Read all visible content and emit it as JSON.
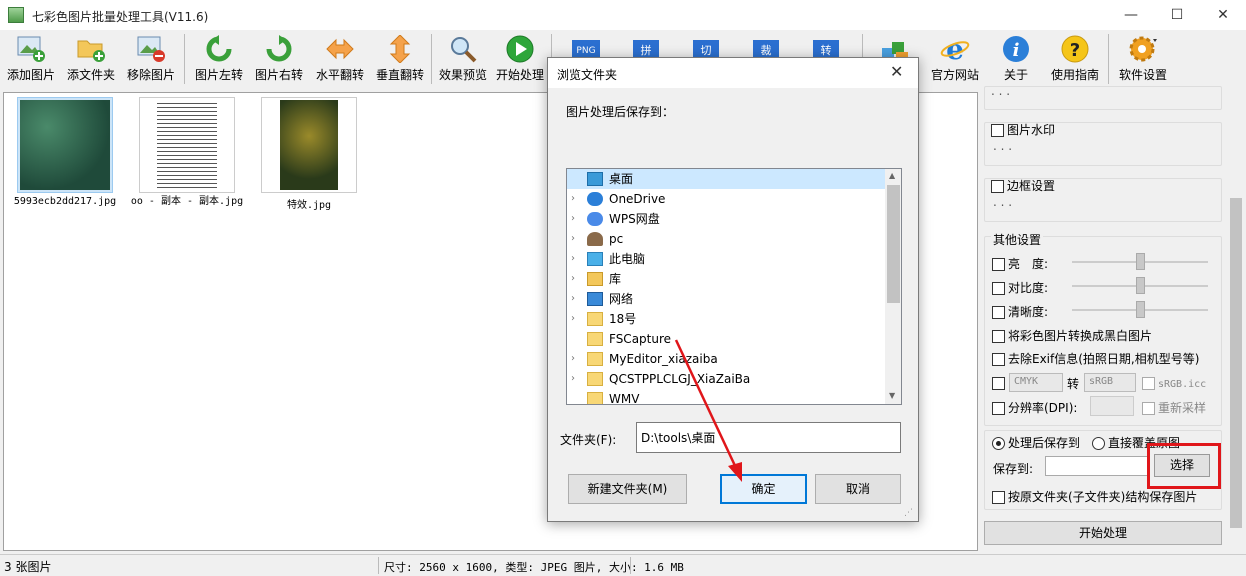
{
  "app": {
    "title": "七彩色图片批量处理工具(V11.6)"
  },
  "window_controls": {
    "minimize": "—",
    "maximize": "☐",
    "close": "✕"
  },
  "toolbar": [
    {
      "label": "添加图片"
    },
    {
      "label": "添文件夹"
    },
    {
      "label": "移除图片"
    },
    {
      "label": "图片左转"
    },
    {
      "label": "图片右转"
    },
    {
      "label": "水平翻转"
    },
    {
      "label": "垂直翻转"
    },
    {
      "label": "效果预览"
    },
    {
      "label": "开始处理"
    }
  ],
  "toolbar_right": [
    {
      "label": "官方网站"
    },
    {
      "label": "关于"
    },
    {
      "label": "使用指南"
    },
    {
      "label": "软件设置"
    }
  ],
  "toolbar_mid_icons": [
    "PNG",
    "拼",
    "切",
    "裁",
    "转"
  ],
  "images": [
    {
      "name": "5993ecb2dd217.jpg"
    },
    {
      "name": "oo - 副本 - 副本.jpg"
    },
    {
      "name": "特效.jpg"
    }
  ],
  "right_panel": {
    "dots": ". . .",
    "watermark": "图片水印",
    "border": "边框设置",
    "other_title": "其他设置",
    "brightness": "亮　度:",
    "contrast": "对比度:",
    "sharpness": "清晰度:",
    "grayscale": "将彩色图片转换成黑白图片",
    "remove_exif": "去除Exif信息(拍照日期,相机型号等)",
    "cmyk": "CMYK",
    "convert_to": "转",
    "srgb": "sRGB",
    "srgb_icc": "sRGB.icc",
    "dpi": "分辨率(DPI):",
    "resample": "重新采样",
    "save_after": "处理后保存到",
    "overwrite": "直接覆盖原图",
    "save_to": "保存到:",
    "select_btn": "选择",
    "keep_structure": "按原文件夹(子文件夹)结构保存图片",
    "start_btn": "开始处理"
  },
  "status": {
    "count": "3 张图片",
    "info": "尺寸: 2560 x 1600, 类型: JPEG 图片, 大小: 1.6 MB"
  },
  "dialog": {
    "title": "浏览文件夹",
    "close": "✕",
    "prompt": "图片处理后保存到：",
    "tree": [
      {
        "label": "桌面",
        "icon": "desktop-folder-icon",
        "selected": true,
        "arrow": ""
      },
      {
        "label": "OneDrive",
        "icon": "onedrive-icon",
        "arrow": "›"
      },
      {
        "label": "WPS网盘",
        "icon": "cloud-drive-icon",
        "arrow": "›"
      },
      {
        "label": "pc",
        "icon": "user-icon",
        "arrow": "›"
      },
      {
        "label": "此电脑",
        "icon": "computer-icon",
        "arrow": "›"
      },
      {
        "label": "库",
        "icon": "library-icon",
        "arrow": "›"
      },
      {
        "label": "网络",
        "icon": "network-icon",
        "arrow": "›"
      },
      {
        "label": "18号",
        "icon": "folder-icon",
        "arrow": "›"
      },
      {
        "label": "FSCapture",
        "icon": "folder-icon",
        "arrow": ""
      },
      {
        "label": "MyEditor_xiazaiba",
        "icon": "folder-icon",
        "arrow": "›"
      },
      {
        "label": "QCSTPPLCLGJ_XiaZaiBa",
        "icon": "folder-icon",
        "arrow": "›"
      },
      {
        "label": "WMV",
        "icon": "folder-icon",
        "arrow": ""
      }
    ],
    "folder_label": "文件夹(F):",
    "folder_value": "D:\\tools\\桌面",
    "new_folder_btn": "新建文件夹(M)",
    "ok_btn": "确定",
    "cancel_btn": "取消"
  },
  "colors": {
    "highlight": "#e0161a",
    "accent": "#0078d7",
    "selection": "#cce8ff"
  }
}
